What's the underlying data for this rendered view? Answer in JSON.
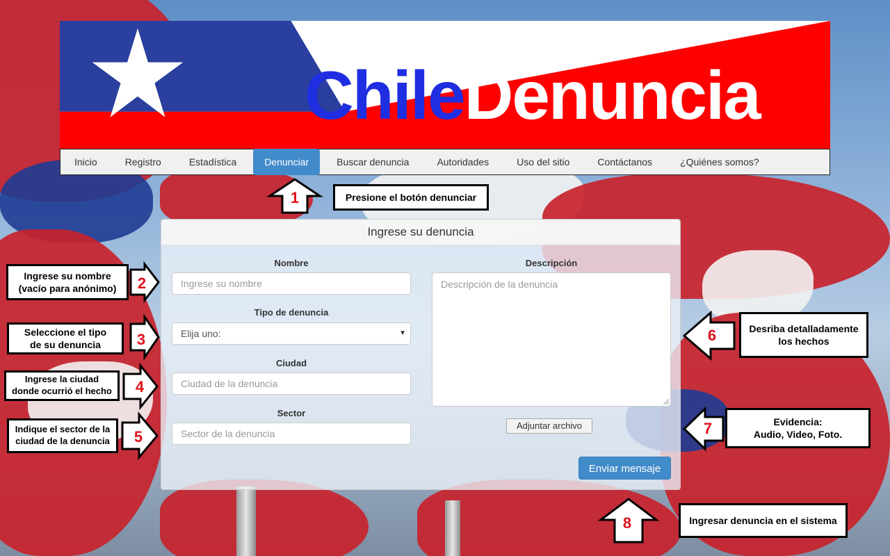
{
  "banner": {
    "title_part1": "Chile",
    "title_part2": "Denuncia"
  },
  "nav": {
    "items": [
      {
        "label": "Inicio",
        "active": false
      },
      {
        "label": "Registro",
        "active": false
      },
      {
        "label": "Estadística",
        "active": false
      },
      {
        "label": "Denunciar",
        "active": true
      },
      {
        "label": "Buscar denuncia",
        "active": false
      },
      {
        "label": "Autoridades",
        "active": false
      },
      {
        "label": "Uso del sitio",
        "active": false
      },
      {
        "label": "Contáctanos",
        "active": false
      },
      {
        "label": "¿Quiénes somos?",
        "active": false
      }
    ]
  },
  "form": {
    "title": "Ingrese su denuncia",
    "nombre": {
      "label": "Nombre",
      "placeholder": "Ingrese su nombre"
    },
    "tipo": {
      "label": "Tipo de denuncia",
      "selected": "Elija uno:"
    },
    "ciudad": {
      "label": "Ciudad",
      "placeholder": "Ciudad de la denuncia"
    },
    "sector": {
      "label": "Sector",
      "placeholder": "Sector de la denuncia"
    },
    "descripcion": {
      "label": "Descripción",
      "placeholder": "Descripción de la denuncia"
    },
    "attach_label": "Adjuntar archivo",
    "submit_label": "Enviar mensaje"
  },
  "callouts": {
    "c1": {
      "num": "1",
      "text": "Presione el botón denunciar"
    },
    "c2": {
      "num": "2",
      "line1": "Ingrese su nombre",
      "line2": "(vacío para anónimo)"
    },
    "c3": {
      "num": "3",
      "line1": "Seleccione el tipo",
      "line2": "de su denuncia"
    },
    "c4": {
      "num": "4",
      "line1": "Ingrese la ciudad",
      "line2": "donde ocurrió el hecho"
    },
    "c5": {
      "num": "5",
      "line1": "Indique el sector de la",
      "line2": "ciudad de la denuncia"
    },
    "c6": {
      "num": "6",
      "line1": "Desriba detalladamente",
      "line2": "los hechos"
    },
    "c7": {
      "num": "7",
      "line1": "Evidencia:",
      "line2": "Audio, Video, Foto."
    },
    "c8": {
      "num": "8",
      "text": "Ingresar denuncia en el sistema"
    }
  },
  "colors": {
    "accent": "#428bca",
    "callout_number": "#e0121b",
    "flag_red": "#ff0000",
    "flag_blue": "#2a3f9e"
  }
}
